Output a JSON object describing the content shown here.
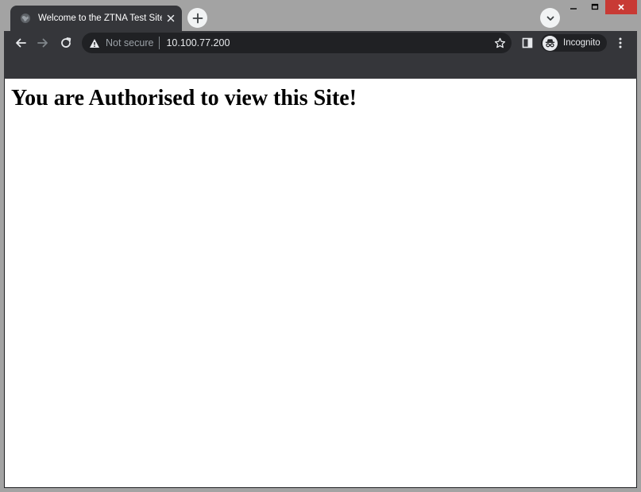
{
  "tab": {
    "title": "Welcome to the ZTNA Test Site!",
    "favicon": "globe-icon",
    "close": "close-icon"
  },
  "new_tab": {
    "icon": "plus-icon"
  },
  "tab_search": {
    "icon": "chevron-down-icon"
  },
  "window_controls": {
    "minimize": "minimize-icon",
    "maximize": "maximize-icon",
    "close": "close-icon",
    "close_color": "#c83a35"
  },
  "toolbar": {
    "back": "arrow-left-icon",
    "forward": "arrow-right-icon",
    "reload": "reload-icon",
    "security_label": "Not secure",
    "security_icon": "warning-icon",
    "url": "10.100.77.200",
    "bookmark": "star-icon",
    "side_panel": "side-panel-icon",
    "profile_label": "Incognito",
    "profile_icon": "incognito-icon",
    "menu": "kebab-menu-icon"
  },
  "page": {
    "heading": "You are Authorised to view this Site!"
  },
  "colors": {
    "frame": "#a3a3a3",
    "toolbar": "#35363a",
    "omnibox": "#202124",
    "content": "#ffffff"
  }
}
